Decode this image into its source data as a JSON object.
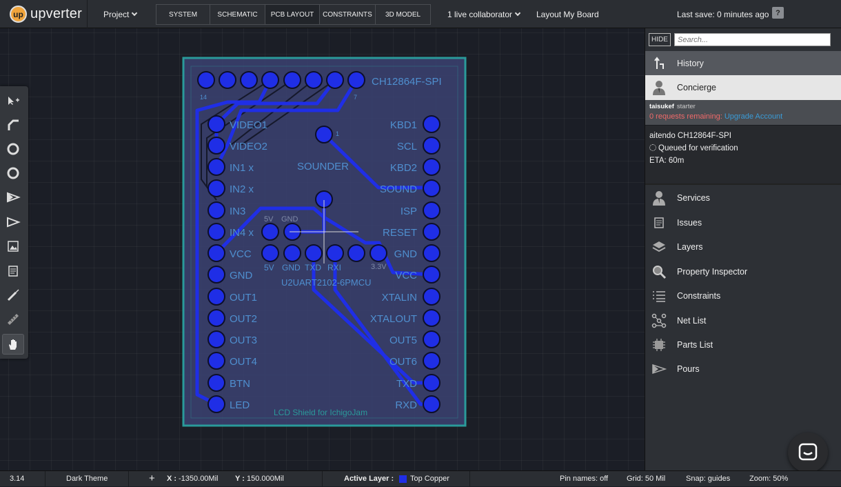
{
  "app": {
    "logo_text": "upverter",
    "logo_mark": "up"
  },
  "topbar": {
    "project_label": "Project",
    "tabs": [
      {
        "label": "SYSTEM"
      },
      {
        "label": "SCHEMATIC"
      },
      {
        "label": "PCB LAYOUT",
        "active": true
      },
      {
        "label": "CONSTRAINTS"
      },
      {
        "label": "3D MODEL"
      }
    ],
    "collaborators_label": "1 live collaborator",
    "layout_label": "Layout My Board",
    "last_save": "Last save: 0 minutes ago",
    "help_label": "?"
  },
  "board": {
    "header_label": "CH12864F-SPI",
    "pin14": "14",
    "pin7": "7",
    "pin1": "1",
    "left_labels": [
      "VIDEO1",
      "VIDEO2",
      "IN1 x",
      "IN2 x",
      "IN3",
      "IN4 x",
      "VCC",
      "GND",
      "OUT1",
      "OUT2",
      "OUT3",
      "OUT4",
      "BTN",
      "LED"
    ],
    "right_labels": [
      "KBD1",
      "SCL",
      "KBD2",
      "SOUND",
      "ISP",
      "RESET",
      "GND",
      "VCC",
      "XTALIN",
      "XTALOUT",
      "OUT5",
      "OUT6",
      "TXD",
      "RXD"
    ],
    "sounder_label": "SOUNDER",
    "top_small_labels": [
      "5V",
      "GND"
    ],
    "bottom_small_labels": [
      "5V",
      "GND",
      "TXD",
      "RXI"
    ],
    "label_3v3": "3.3V",
    "uart_label": "U2UART2102-6PMCU",
    "silk_label": "LCD Shield for IchigoJam"
  },
  "panel": {
    "hide_label": "HIDE",
    "search_placeholder": "Search...",
    "history_label": "History",
    "concierge_label": "Concierge",
    "username": "taisukef",
    "plan": "starter",
    "requests_text": "0 requests remaining:",
    "upgrade_text": "Upgrade Account",
    "note_title": "aitendo CH12864F-SPI",
    "note_status": "Queued for verification",
    "note_eta": "ETA: 60m",
    "menu": [
      {
        "label": "Services",
        "icon": "person-icon"
      },
      {
        "label": "Issues",
        "icon": "document-icon"
      },
      {
        "label": "Layers",
        "icon": "layers-icon"
      },
      {
        "label": "Property Inspector",
        "icon": "magnifier-icon"
      },
      {
        "label": "Constraints",
        "icon": "list-icon"
      },
      {
        "label": "Net List",
        "icon": "netlist-icon"
      },
      {
        "label": "Parts List",
        "icon": "chip-icon"
      },
      {
        "label": "Pours",
        "icon": "pour-icon"
      }
    ]
  },
  "statusbar": {
    "version": "3.14",
    "theme": "Dark Theme",
    "x_label": "X :",
    "x_value": "-1350.00Mil",
    "y_label": "Y :",
    "y_value": "150.000Mil",
    "active_layer_label": "Active Layer :",
    "active_layer_value": "Top Copper",
    "active_layer_color": "#1f2ee6",
    "pin_names": "Pin names: off",
    "grid": "Grid: 50 Mil",
    "snap": "Snap: guides",
    "zoom": "Zoom: 50%"
  },
  "colors": {
    "copper": "#1f2ee6",
    "board_outline": "#2a9a9a",
    "board_fill": "#3b4272",
    "pad_text": "#4f8fcf"
  }
}
